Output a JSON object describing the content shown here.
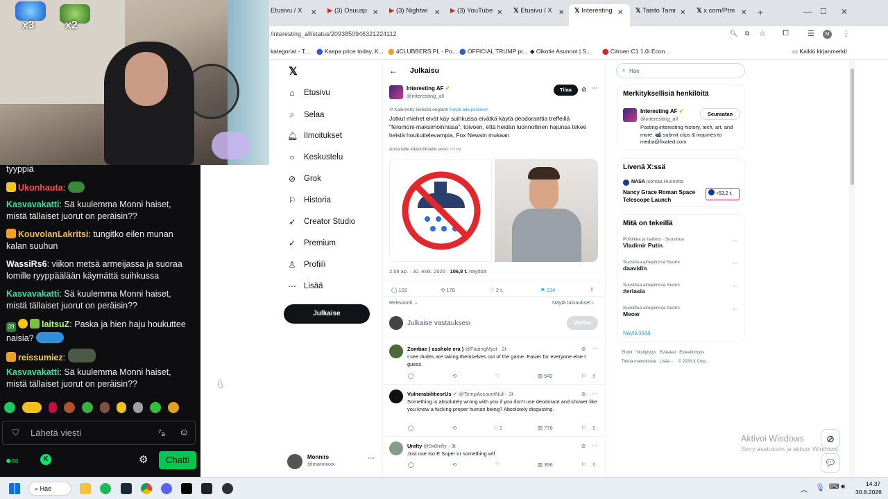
{
  "overlay": {
    "emote_count_1": "x3",
    "emote_count_2": "x2"
  },
  "chat": {
    "messages": [
      {
        "user": "",
        "text": "tyyppiä"
      },
      {
        "user": "Ukonhauta",
        "text": ":",
        "user_color": "#ff4d4d"
      },
      {
        "user": "Kasvavakatti",
        "text": ": Sä kuulemma Monni haiset, mistä tällaiset juorut on peräisin??",
        "user_color": "#38e0a0"
      },
      {
        "user": "KouvolanLakritsi",
        "text": ": tungitko eilen munan kalan suuhun",
        "user_color": "#f0c040"
      },
      {
        "user": "WassiRs6",
        "text": ": viikon metsä armeijassa ja suoraa lomille ryyppäälään käymättä suihkussa",
        "user_color": "#ffffff"
      },
      {
        "user": "Kasvavakatti",
        "text": ": Sä kuulemma Monni haiset, mistä tällaiset juorut on peräisin??",
        "user_color": "#38e0a0"
      },
      {
        "user": "laitsuZ",
        "text": ": Paska ja hien haju houkuttee naisia?",
        "user_color": "#b3ff66"
      },
      {
        "user": "reissumiez",
        "text": ":",
        "user_color": "#f0d040"
      },
      {
        "user": "Kasvavakatti",
        "text": ": Sä kuulemma Monni haiset, mistä tällaiset juorut on peräisin??",
        "user_color": "#38e0a0"
      }
    ],
    "sub_badge_label": "39",
    "input_placeholder": "Lähetä viesti",
    "chat_button": "Chatti"
  },
  "browser": {
    "tabs": [
      {
        "label": "Etusivu / X"
      },
      {
        "label": "(3) Osuusp"
      },
      {
        "label": "(3) Nightwi"
      },
      {
        "label": "(3) YouTube"
      },
      {
        "label": "Etusivu / X"
      },
      {
        "label": "Interesting"
      },
      {
        "label": "Taisto Tamm"
      },
      {
        "label": "x.com/Ptm"
      }
    ],
    "url": "/interesting_all/status/2093850946321224112",
    "bookmarks": [
      {
        "label": "kategoriat - T..."
      },
      {
        "label": "Kaspa price today, K..."
      },
      {
        "label": "4CLUBBERS.PL - Po..."
      },
      {
        "label": "OFFICIAL TRUMP pr..."
      },
      {
        "label": "Oikotie Asunnot | S..."
      },
      {
        "label": "Citroen C1 1,0i Econ..."
      },
      {
        "label": "Kaikki kirjanmerkit"
      }
    ]
  },
  "xnav": {
    "items": [
      {
        "label": "Etusivu",
        "icon": "home-icon"
      },
      {
        "label": "Selaa",
        "icon": "search-icon"
      },
      {
        "label": "Ilmoitukset",
        "icon": "bell-icon"
      },
      {
        "label": "Keskustelu",
        "icon": "chat-icon"
      },
      {
        "label": "Grok",
        "icon": "grok-icon"
      },
      {
        "label": "Historia",
        "icon": "bookmark-icon"
      },
      {
        "label": "Creator Studio",
        "icon": "rocket-icon"
      },
      {
        "label": "Premium",
        "icon": "verified-icon"
      },
      {
        "label": "Profiili",
        "icon": "person-icon"
      },
      {
        "label": "Lisää",
        "icon": "more-icon"
      }
    ],
    "post_button": "Julkaise",
    "account_name": "Monnirs",
    "account_handle": "@monnixxx"
  },
  "post": {
    "header": "Julkaisu",
    "author": "Interesting AF",
    "handle": "@interesting_all",
    "subscribe": "Tilaa",
    "translated_note": "Käännetty kielestä englanti",
    "show_original": "Näytä alkuperäinen",
    "text": "Jotkut miehet eivät käy suihkussa eivätkä käytä deodoranttia treffeillä \"feromoni-maksimoinnissa\", toivoen, että heidän luonnollinen hajunsa tekee heistä houkuttelevampia, Fox Newsin mukaan",
    "rate_translation": "Anna tälle käännökselle arvio:",
    "time": "2.59 ap. · 30. elok. 2026 ·",
    "views": "106,8 t.",
    "views_label": "näyttöä",
    "stats": {
      "replies": "102",
      "reposts": "178",
      "likes": "2 t.",
      "bookmarks": "214"
    },
    "relevant": "Relevantti",
    "quotes": "Näytä lainaukset",
    "reply_placeholder": "Julkaise vastauksesi",
    "reply_button": "Vastaa"
  },
  "replies": [
    {
      "name": "Zombae ( asshole era )",
      "handle": "@FadingMyst · 2t",
      "text": "I see dudes are taking themselves out of the game. Easier for everyone else I guess.",
      "likes": "",
      "views": "542"
    },
    {
      "name": "VulnerabilitiesrUs",
      "handle": "@TempAccountNull · 3t",
      "text": "Something is absolutely wrong with you if you don't use deodorant and shower like you know a fucking proper human being? Absolutely disgusting.",
      "likes": "1",
      "views": "776"
    },
    {
      "name": "Unifty",
      "handle": "@0x8nifty · 3t",
      "text": "Just use Iso E Super or something wtf",
      "likes": "",
      "views": "396"
    }
  ],
  "sidebar": {
    "search_placeholder": "Hae",
    "people_title": "Merkityksellisiä henkilöitä",
    "person_name": "Interesting AF",
    "person_handle": "@interesting_all",
    "follow": "Seuraatan",
    "person_bio": "Posting interesting history, tech, art, and more. 📹 submit clips & inquiries to media@fixated.com",
    "live_title": "Livenä X:ssä",
    "live_host": "NASA",
    "live_host_note": "juontaa Huonetta",
    "live_event": "Nancy Grace Roman Space Telescope Launch",
    "live_count": "+53,2 t.",
    "trends_title": "Mitä on tekeillä",
    "trends": [
      {
        "category": "Politiikka ja hallinto · Suosittua",
        "name": "Vladimir Putin"
      },
      {
        "category": "Suosittua aihepiirissä Suomi",
        "name": "daavidin"
      },
      {
        "category": "Suosittua aihepiirissä Suomi",
        "name": "#eriasia"
      },
      {
        "category": "Suosittua aihepiirissä Suomi",
        "name": "Meow"
      }
    ],
    "show_more": "Näytä lisää",
    "footer": "Ehdot   Yksityisyys   Evästeet   Esteettömyys",
    "footer2": "Tietoa mainoksista   Lisää ···   © 2026 X Corp."
  },
  "windows": {
    "activate": "Aktivoi Windows",
    "activate_sub": "Siirry asetuksiin ja aktivoi Windows.",
    "search": "Hae",
    "time": "14.37",
    "date": "30.8.2026"
  },
  "colors": {
    "twitch_green": "#00c853",
    "x_blue": "#1d9bf0",
    "x_black": "#0f1419"
  }
}
